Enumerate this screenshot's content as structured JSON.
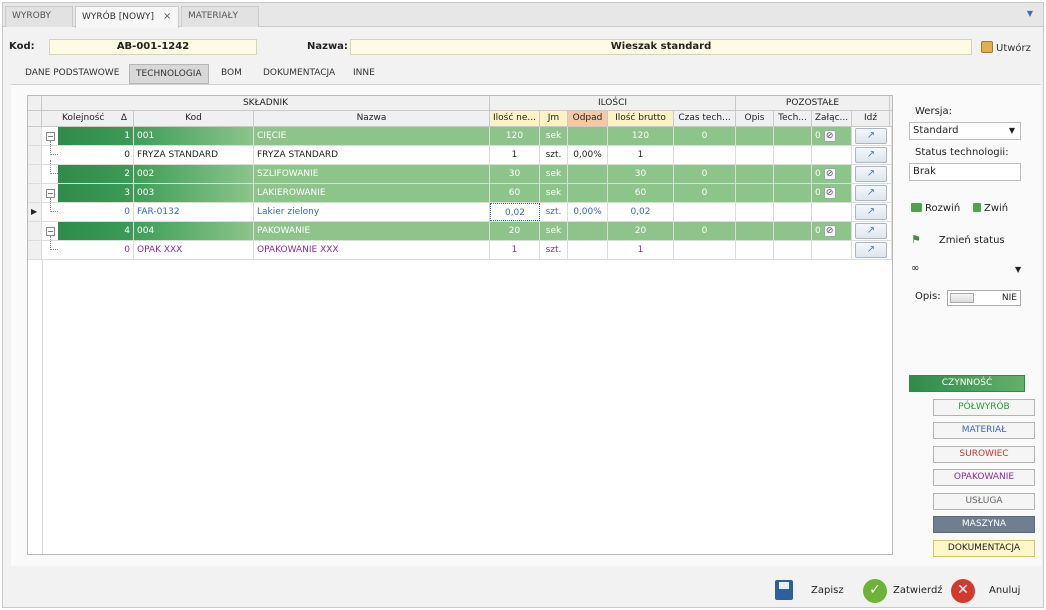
{
  "tabs": [
    {
      "label": "WYROBY"
    },
    {
      "label": "WYRÓB [NOWY]",
      "close": "×"
    },
    {
      "label": "MATERIAŁY"
    }
  ],
  "header": {
    "kod_label": "Kod:",
    "kod_value": "AB-001-1242",
    "nazwa_label": "Nazwa:",
    "nazwa_value": "Wieszak standard",
    "utworz": "Utwórz"
  },
  "subtabs": [
    "DANE PODSTAWOWE",
    "TECHNOLOGIA",
    "BOM",
    "DOKUMENTACJA",
    "INNE"
  ],
  "grid": {
    "groups": {
      "skladnik": "SKŁADNIK",
      "ilosci": "ILOŚCI",
      "pozostale": "POZOSTAŁE"
    },
    "columns": {
      "kolejnosc": "Kolejność",
      "sort": "Δ",
      "kod": "Kod",
      "nazwa": "Nazwa",
      "ilosc_netto": "Ilość ne...",
      "jm": "Jm",
      "odpad": "Odpad",
      "ilosc_brutto": "Ilość brutto",
      "czas": "Czas tech...",
      "opis": "Opis",
      "tech": "Tech...",
      "zal": "Załąc...",
      "idz": "Idź"
    },
    "rows": [
      {
        "kol": "1",
        "kod": "001",
        "nazwa": "CIĘCIE",
        "netto": "120",
        "jm": "sek",
        "odpad": "",
        "brutto": "120",
        "czas": "0",
        "zal": "0"
      },
      {
        "kol": "0",
        "kod": "FRYZA STANDARD",
        "nazwa": "FRYZA STANDARD",
        "netto": "1",
        "jm": "szt.",
        "odpad": "0,00%",
        "brutto": "1",
        "czas": "",
        "zal": ""
      },
      {
        "kol": "2",
        "kod": "002",
        "nazwa": "SZLIFOWANIE",
        "netto": "30",
        "jm": "sek",
        "odpad": "",
        "brutto": "30",
        "czas": "0",
        "zal": "0"
      },
      {
        "kol": "3",
        "kod": "003",
        "nazwa": "LAKIEROWANIE",
        "netto": "60",
        "jm": "sek",
        "odpad": "",
        "brutto": "60",
        "czas": "0",
        "zal": "0"
      },
      {
        "kol": "0",
        "kod": "FAR-0132",
        "nazwa": "Lakier zielony",
        "netto": "0,02",
        "jm": "szt.",
        "odpad": "0,00%",
        "brutto": "0,02",
        "czas": "",
        "zal": ""
      },
      {
        "kol": "4",
        "kod": "004",
        "nazwa": "PAKOWANIE",
        "netto": "20",
        "jm": "sek",
        "odpad": "",
        "brutto": "20",
        "czas": "0",
        "zal": "0"
      },
      {
        "kol": "0",
        "kod": "OPAK XXX",
        "nazwa": "OPAKOWANIE XXX",
        "netto": "1",
        "jm": "szt.",
        "odpad": "",
        "brutto": "1",
        "czas": "",
        "zal": ""
      }
    ]
  },
  "side": {
    "wersja_label": "Wersja:",
    "wersja_value": "Standard",
    "status_label": "Status technologii:",
    "status_value": "Brak",
    "rozwin": "Rozwiń",
    "zwin": "Zwiń",
    "zmien_status": "Zmień status",
    "opis_label": "Opis:",
    "opis_toggle": "NIE"
  },
  "legend": {
    "czynnosc": "CZYNNOŚĆ",
    "polwyrob": "PÓŁWYRÓB",
    "material": "MATERIAŁ",
    "surowiec": "SUROWIEC",
    "opakowanie": "OPAKOWANIE",
    "usluga": "USŁUGA",
    "maszyna": "MASZYNA",
    "dokumentacja": "DOKUMENTACJA"
  },
  "footer": {
    "zapisz": "Zapisz",
    "zatwierdz": "Zatwierdź",
    "anuluj": "Anuluj"
  },
  "colors": {
    "operation_green": "#8cc48a",
    "operation_dark": "#2f8b4b",
    "material_blue": "#3a66b5",
    "packaging_purple": "#8e2aa0",
    "surowiec_red": "#c0392b"
  }
}
